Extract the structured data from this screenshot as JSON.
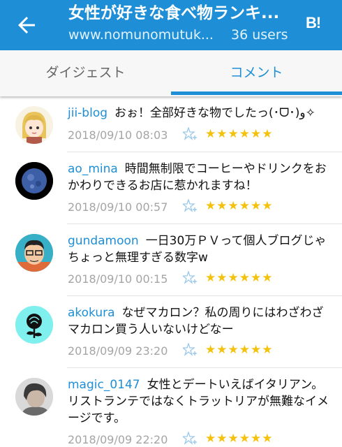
{
  "appbar": {
    "title": "女性が好きな食べ物ランキ...",
    "url": "www.nomunomutuk...",
    "users": "36 users",
    "hatena_logo": "B!"
  },
  "tabs": [
    {
      "label": "ダイジェスト",
      "selected": false
    },
    {
      "label": "コメント",
      "selected": true
    }
  ],
  "comments": [
    {
      "user": "jii-blog",
      "text": "おぉ！全部好きな物でしたっ(･ᗜ･)و✧",
      "date": "2018/09/10 08:03",
      "stars": "★★★★★★"
    },
    {
      "user": "ao_mina",
      "text": "時間無制限でコーヒーやドリンクをおかわりできるお店に惹かれますね！",
      "date": "2018/09/10 00:57",
      "stars": "★★★★★★"
    },
    {
      "user": "gundamoon",
      "text": "一日30万ＰＶって個人ブログじゃちょっと無理すぎる数字w",
      "date": "2018/09/10 00:15",
      "stars": "★★★★★★"
    },
    {
      "user": "akokura",
      "text": "なぜマカロン？私の周りにはわざわざマカロン買う人いないけどなー",
      "date": "2018/09/09 23:20",
      "stars": "★★★★★★"
    },
    {
      "user": "magic_0147",
      "text": "女性とデートいえばイタリアン。リストランテではなくトラットリアが無難なイメージです。",
      "date": "2018/09/09 22:20",
      "stars": "★★★★★★"
    }
  ]
}
